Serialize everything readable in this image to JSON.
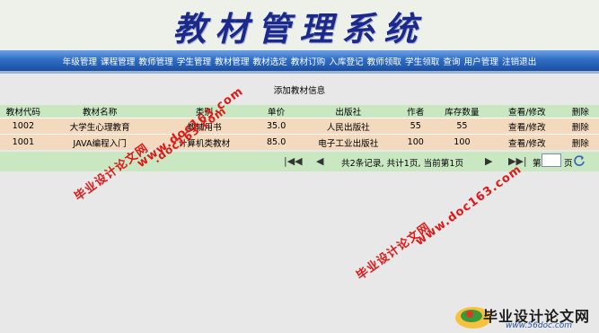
{
  "app": {
    "title": "教材管理系统"
  },
  "nav": {
    "items": [
      "年级管理",
      "课程管理",
      "教师管理",
      "学生管理",
      "教材管理",
      "教材选定",
      "教材订购",
      "入库登记",
      "教师领取",
      "学生领取",
      "查询",
      "用户管理",
      "注销退出"
    ]
  },
  "main": {
    "add_link": "添加教材信息",
    "columns": [
      "教材代码",
      "教材名称",
      "类别",
      "单价",
      "出版社",
      "作者",
      "库存数量",
      "查看/修改",
      "删除"
    ],
    "rows": [
      {
        "code": "1002",
        "name": "大学生心理教育",
        "category": "教辅用书",
        "price": "35.0",
        "publisher": "人民出版社",
        "author": "55",
        "stock": "55",
        "view": "查看/修改",
        "del": "删除"
      },
      {
        "code": "1001",
        "name": "JAVA编程入门",
        "category": "计算机类教材",
        "price": "85.0",
        "publisher": "电子工业出版社",
        "author": "100",
        "stock": "100",
        "view": "查看/修改",
        "del": "删除"
      }
    ]
  },
  "pager": {
    "info": "共2条记录, 共计1页, 当前第1页",
    "goto_prefix": "第",
    "goto_suffix": "页",
    "goto_value": ""
  },
  "watermarks": {
    "site_cn": "毕业设计论文网",
    "site_url": "www.doc163.com",
    "site_url_short": ".doc163.com"
  },
  "logo": {
    "name": "毕业设计论文网",
    "url": "www.56doc.com"
  },
  "colors": {
    "title": "#1b2a8a",
    "nav_bg": "#2f6ec4",
    "header_row": "#c9e8c2",
    "data_row": "#f3d9bd",
    "watermark": "#e01818"
  }
}
